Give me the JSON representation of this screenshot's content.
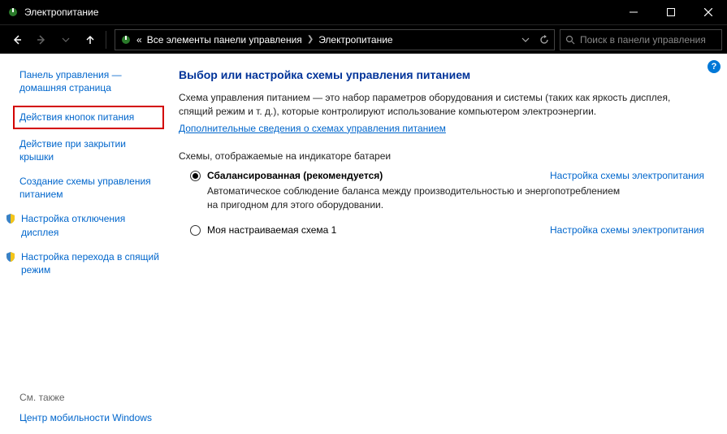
{
  "titlebar": {
    "title": "Электропитание"
  },
  "breadcrumb": {
    "prefix": "«",
    "level1": "Все элементы панели управления",
    "level2": "Электропитание"
  },
  "search": {
    "placeholder": "Поиск в панели управления"
  },
  "sidebar": {
    "home": "Панель управления — домашняя страница",
    "items": [
      "Действия кнопок питания",
      "Действие при закрытии крышки",
      "Создание схемы управления питанием",
      "Настройка отключения дисплея",
      "Настройка перехода в спящий режим"
    ],
    "see_also_head": "См. также",
    "see_also": "Центр мобильности Windows"
  },
  "main": {
    "heading": "Выбор или настройка схемы управления питанием",
    "desc": "Схема управления питанием — это набор параметров оборудования и системы (таких как яркость дисплея, спящий режим и т. д.), которые контролируют использование компьютером электроэнергии.",
    "more_link": "Дополнительные сведения о схемах управления питанием",
    "section": "Схемы, отображаемые на индикаторе батареи",
    "plans": [
      {
        "name": "Сбалансированная (рекомендуется)",
        "checked": true,
        "link": "Настройка схемы электропитания",
        "desc": "Автоматическое соблюдение баланса между производительностью и энергопотреблением на пригодном для этого оборудовании."
      },
      {
        "name": "Моя настраиваемая схема 1",
        "checked": false,
        "link": "Настройка схемы электропитания",
        "desc": ""
      }
    ]
  }
}
